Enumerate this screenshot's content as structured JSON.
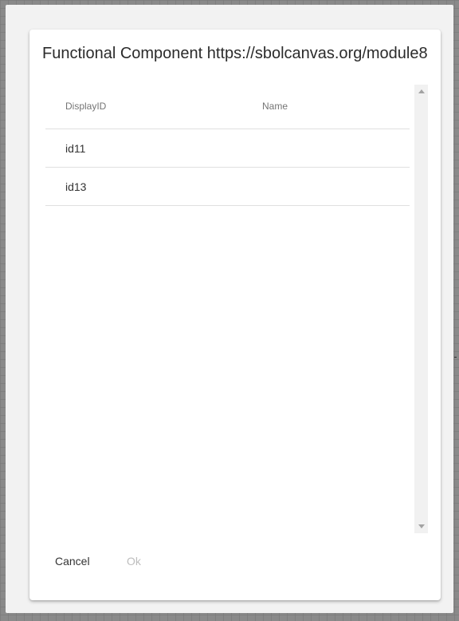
{
  "dialog": {
    "title": "Functional Component https://sbolcanvas.org/module8"
  },
  "table": {
    "columns": [
      "DisplayID",
      "Name"
    ],
    "rows": [
      {
        "display_id": "id11",
        "name": ""
      },
      {
        "display_id": "id13",
        "name": ""
      }
    ]
  },
  "actions": {
    "cancel_label": "Cancel",
    "ok_label": "Ok",
    "ok_disabled": true
  }
}
